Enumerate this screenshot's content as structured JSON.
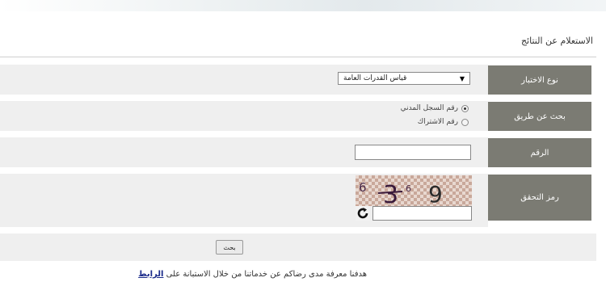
{
  "page": {
    "title": "الاستعلام عن النتائج"
  },
  "form": {
    "exam_type": {
      "label": "نوع الاختبار",
      "selected": "قياس القدرات العامة"
    },
    "search_by": {
      "label": "بحث عن طريق",
      "options": [
        {
          "label": "رقم السجل المدني",
          "selected": true
        },
        {
          "label": "رقم الاشتراك",
          "selected": false
        }
      ]
    },
    "number": {
      "label": "الرقم",
      "value": ""
    },
    "captcha": {
      "label": "رمز التحقق",
      "image_text": "6 3 6 9",
      "value": ""
    },
    "submit_label": "بحث"
  },
  "footer": {
    "text": "هدفنا معرفة مدى رضاكم عن خدماتنا من خلال الاستبانة على",
    "link_label": "الرابط"
  },
  "colors": {
    "label_bg": "#7b7b73",
    "row_bg": "#efefef",
    "link": "#1a2a8a"
  },
  "icons": {
    "refresh": "refresh-icon",
    "dropdown": "triangle-down-icon"
  }
}
